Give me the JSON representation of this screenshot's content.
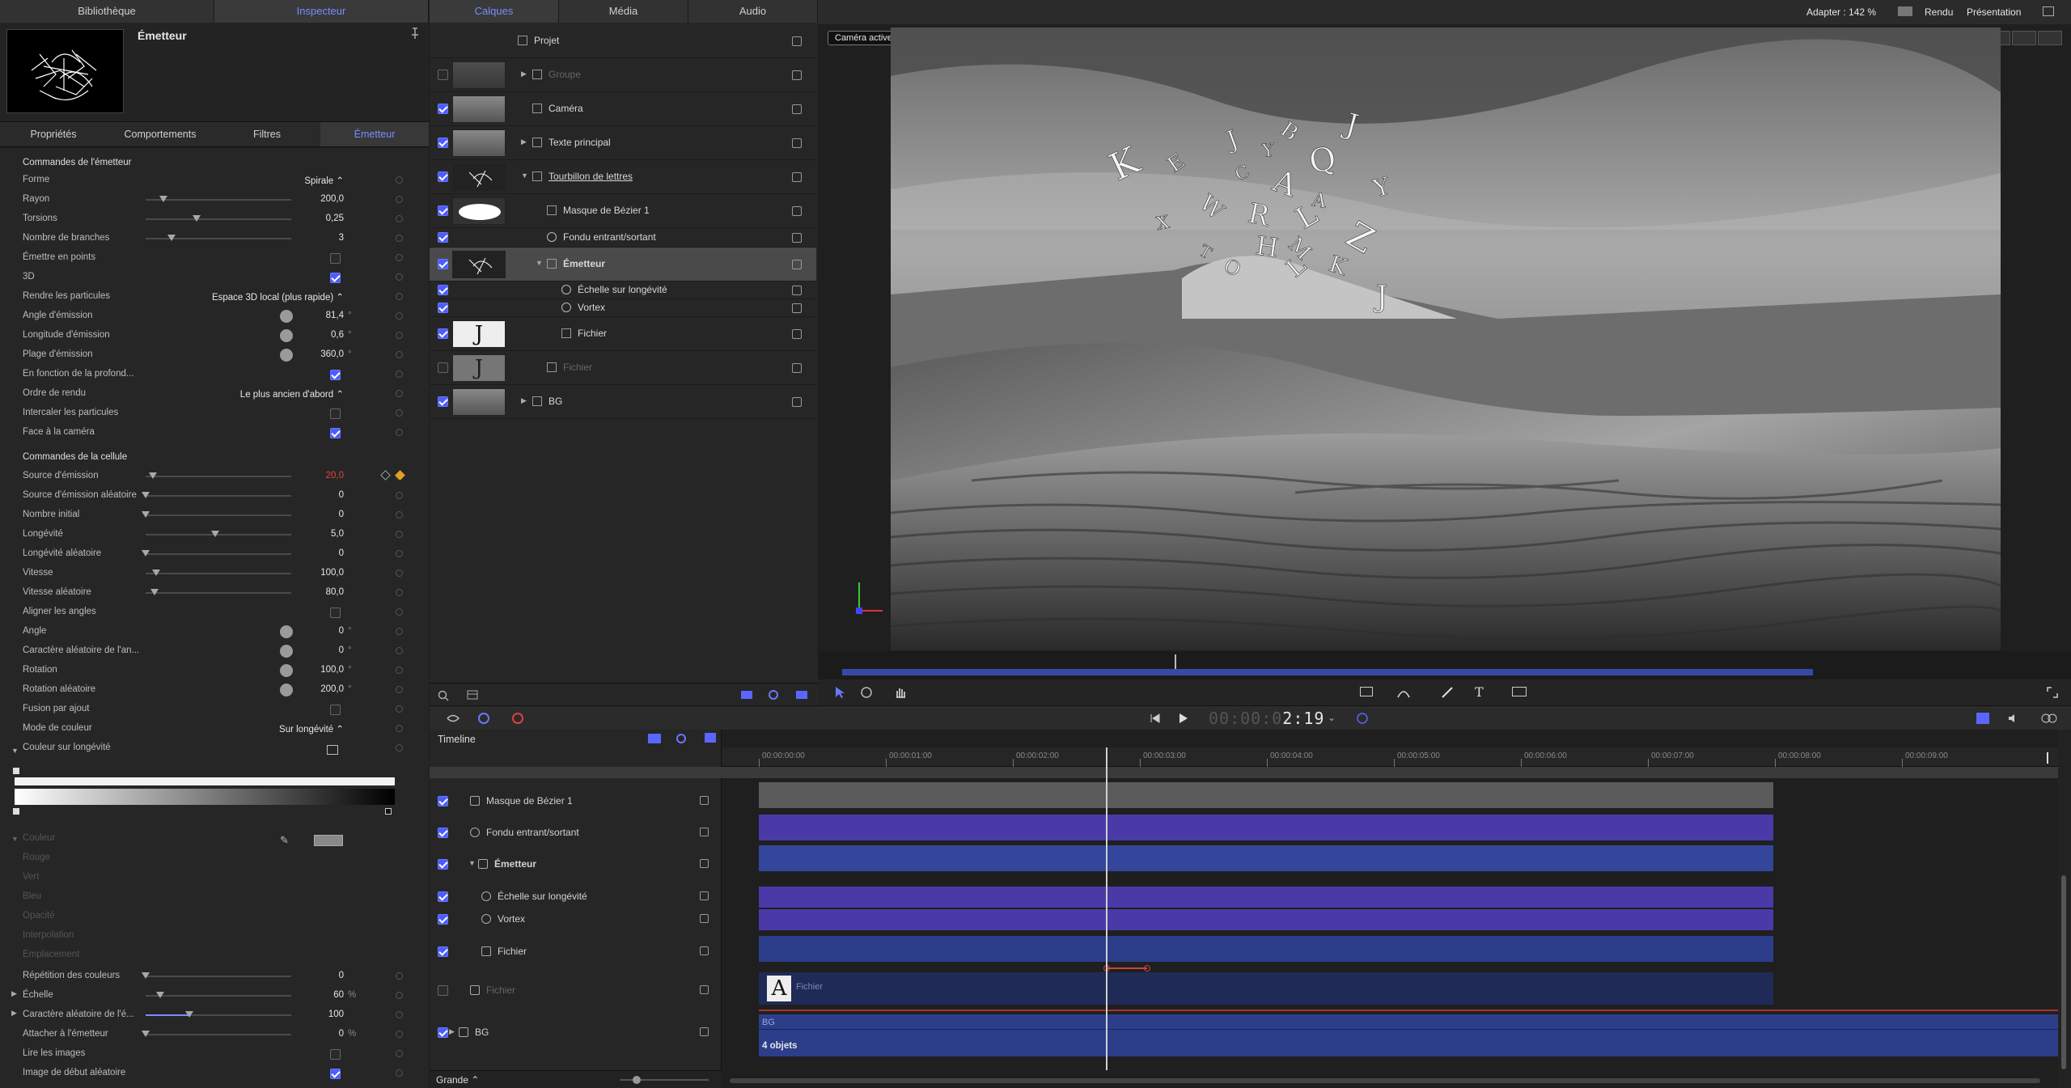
{
  "left_tabs": {
    "library": "Bibliothèque",
    "inspector": "Inspecteur"
  },
  "inspector": {
    "title": "Émetteur",
    "tabs": [
      "Propriétés",
      "Comportements",
      "Filtres",
      "Émetteur"
    ],
    "sections": {
      "emitter": "Commandes de l'émetteur",
      "cell": "Commandes de la cellule"
    },
    "emitter_rows": [
      {
        "label": "Forme",
        "value": "Spirale ⌃"
      },
      {
        "label": "Rayon",
        "value": "200,0",
        "slider": 0.12
      },
      {
        "label": "Torsions",
        "value": "0,25",
        "slider": 0.35
      },
      {
        "label": "Nombre de branches",
        "value": "3",
        "slider": 0.18
      },
      {
        "label": "Émettre en points",
        "check": false
      },
      {
        "label": "3D",
        "check": true
      },
      {
        "label": "Rendre les particules",
        "value": "Espace 3D local (plus rapide) ⌃"
      },
      {
        "label": "Angle d'émission",
        "value": "81,4",
        "unit": "°",
        "dial": true
      },
      {
        "label": "Longitude d'émission",
        "value": "0,6",
        "unit": "°",
        "dial": true
      },
      {
        "label": "Plage d'émission",
        "value": "360,0",
        "unit": "°",
        "dial": true
      },
      {
        "label": "En fonction de la profond...",
        "check": true
      },
      {
        "label": "Ordre de rendu",
        "value": "Le plus ancien d'abord ⌃"
      },
      {
        "label": "Intercaler les particules",
        "check": false
      },
      {
        "label": "Face à la caméra",
        "check": true
      }
    ],
    "cell_rows": [
      {
        "label": "Source d'émission",
        "value": "20,0",
        "slider": 0.05,
        "red": true
      },
      {
        "label": "Source d'émission aléatoire",
        "value": "0",
        "slider": 0.0
      },
      {
        "label": "Nombre initial",
        "value": "0",
        "slider": 0.0
      },
      {
        "label": "Longévité",
        "value": "5,0",
        "slider": 0.48
      },
      {
        "label": "Longévité aléatoire",
        "value": "0",
        "slider": 0.0
      },
      {
        "label": "Vitesse",
        "value": "100,0",
        "slider": 0.07
      },
      {
        "label": "Vitesse aléatoire",
        "value": "80,0",
        "slider": 0.06
      },
      {
        "label": "Aligner les angles",
        "check": false
      },
      {
        "label": "Angle",
        "value": "0",
        "unit": "°",
        "dial": true
      },
      {
        "label": "Caractère aléatoire de l'an...",
        "value": "0",
        "unit": "°",
        "dial": true
      },
      {
        "label": "Rotation",
        "value": "100,0",
        "unit": "°",
        "dial": true
      },
      {
        "label": "Rotation aléatoire",
        "value": "200,0",
        "unit": "°",
        "dial": true
      },
      {
        "label": "Fusion par ajout",
        "check": false
      },
      {
        "label": "Mode de couleur",
        "value": "Sur longévité ⌃"
      },
      {
        "label": "Couleur sur longévité",
        "value": ""
      }
    ],
    "color_rows": [
      {
        "label": "Couleur",
        "dim": true
      },
      {
        "label": "Rouge",
        "dim": true
      },
      {
        "label": "Vert",
        "dim": true
      },
      {
        "label": "Bleu",
        "dim": true
      },
      {
        "label": "Opacité",
        "dim": true
      },
      {
        "label": "Interpolation",
        "dim": true
      },
      {
        "label": "Emplacement",
        "dim": true
      }
    ],
    "bottom_rows": [
      {
        "label": "Répétition des couleurs",
        "value": "0",
        "slider": 0.0
      },
      {
        "label": "Échelle",
        "value": "60",
        "unit": "%",
        "slider": 0.1,
        "disc": true
      },
      {
        "label": "Caractère aléatoire de l'é...",
        "value": "100",
        "slider": 0.3,
        "disc": true,
        "blue": true
      },
      {
        "label": "Attacher à l'émetteur",
        "value": "0",
        "unit": "%",
        "slider": 0.0
      },
      {
        "label": "Lire les images",
        "check": false
      },
      {
        "label": "Image de début aléatoire",
        "check": true
      }
    ]
  },
  "layers_tabs": [
    "Calques",
    "Média",
    "Audio"
  ],
  "layers": [
    {
      "name": "Projet",
      "indent": 0,
      "nocheck": true
    },
    {
      "name": "Groupe",
      "indent": 1,
      "dim": true,
      "arrow": "▶"
    },
    {
      "name": "Caméra",
      "indent": 1
    },
    {
      "name": "Texte principal",
      "indent": 1,
      "arrow": "▶"
    },
    {
      "name": "Tourbillon de lettres",
      "indent": 1,
      "arrow": "▼",
      "underline": true
    },
    {
      "name": "Masque de Bézier 1",
      "indent": 2
    },
    {
      "name": "Fondu entrant/sortant",
      "indent": 2,
      "small": true
    },
    {
      "name": "Émetteur",
      "indent": 2,
      "arrow": "▼",
      "selected": true
    },
    {
      "name": "Échelle sur longévité",
      "indent": 3,
      "small": true
    },
    {
      "name": "Vortex",
      "indent": 3,
      "small": true
    },
    {
      "name": "Fichier",
      "indent": 3
    },
    {
      "name": "Fichier",
      "indent": 2,
      "dim": true
    },
    {
      "name": "BG",
      "indent": 1,
      "arrow": "▶"
    }
  ],
  "viewer": {
    "camera": "Caméra active",
    "zoom": "Adapter : 142 %",
    "render": "Rendu",
    "presentation": "Présentation",
    "timecode": "00:00:02:19",
    "timecode_dim": "00:00:0",
    "timecode_bright": "2:19"
  },
  "timeline": {
    "title": "Timeline",
    "ruler": [
      "00:00:00:00",
      "00:00:01:00",
      "00:00:02:00",
      "00:00:03:00",
      "00:00:04:00",
      "00:00:05:00",
      "00:00:06:00",
      "00:00:07:00",
      "00:00:08:00",
      "00:00:09:00"
    ],
    "rows": [
      {
        "name": "Masque de Bézier 1"
      },
      {
        "name": "Fondu entrant/sortant"
      },
      {
        "name": "Émetteur"
      },
      {
        "name": "Échelle sur longévité"
      },
      {
        "name": "Vortex"
      },
      {
        "name": "Fichier"
      },
      {
        "name": "Fichier"
      },
      {
        "name": "BG"
      }
    ],
    "bar_labels": {
      "fichier": "Fichier",
      "bg": "BG",
      "objects": "4 objets"
    },
    "size": "Grande"
  },
  "letters": [
    "K",
    "Z",
    "J",
    "Q",
    "A",
    "L",
    "R",
    "J",
    "W",
    "Y",
    "B",
    "H",
    "L",
    "X",
    "J",
    "O",
    "E",
    "K",
    "Y",
    "T",
    "A",
    "C",
    "M"
  ]
}
